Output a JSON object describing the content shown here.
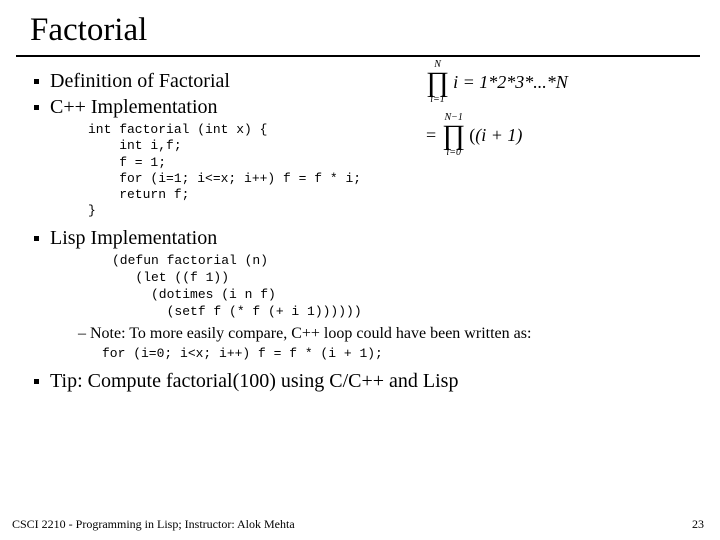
{
  "title": "Factorial",
  "bullets": {
    "b1": "Definition of Factorial",
    "b2": "C++ Implementation",
    "b3": "Lisp Implementation",
    "b4": "Tip: Compute factorial(100) using C/C++ and Lisp"
  },
  "code": {
    "cpp": "int factorial (int x) {\n    int i,f;\n    f = 1;\n    for (i=1; i<=x; i++) f = f * i;\n    return f;\n}",
    "lisp": "(defun factorial (n)\n   (let ((f 1))\n     (dotimes (i n f)\n       (setf f (* f (+ i 1))))))",
    "note_code": "for (i=0; i<x; i++) f = f * (i + 1);"
  },
  "note": "– Note: To more easily compare, C++ loop could have been written as:",
  "formulas": {
    "f1_sup": "N",
    "f1_sub": "i=1",
    "f1_body": "i = 1*2*3*...*N",
    "f2_sup": "N−1",
    "f2_sub": "i=0",
    "f2_body": "(i + 1)",
    "eq": "="
  },
  "footer": "CSCI 2210 - Programming in Lisp; Instructor: Alok Mehta",
  "pagenum": "23"
}
